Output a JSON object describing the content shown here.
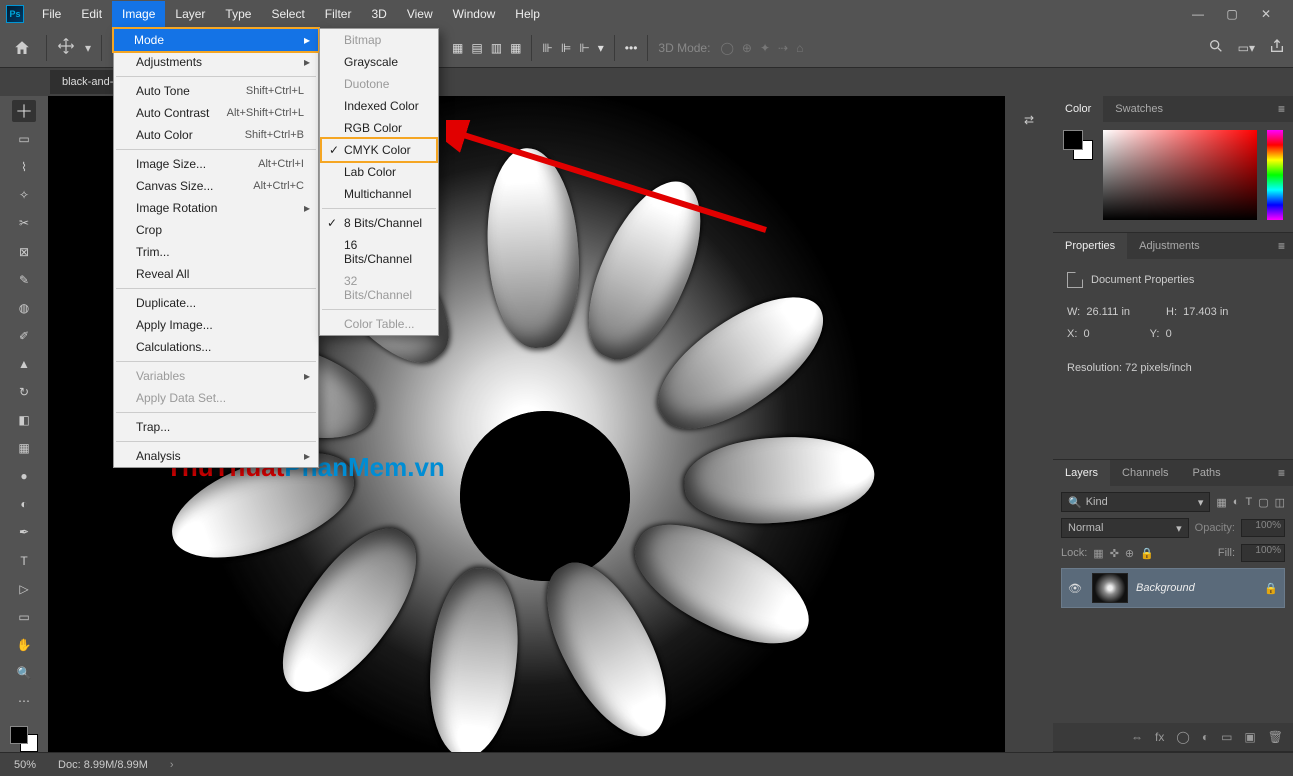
{
  "menubar": [
    "File",
    "Edit",
    "Image",
    "Layer",
    "Type",
    "Select",
    "Filter",
    "3D",
    "View",
    "Window",
    "Help"
  ],
  "active_menu_index": 2,
  "doc_tab": "black-and-",
  "options": {
    "mode3d_label": "3D Mode:"
  },
  "dropdown": {
    "items": [
      {
        "label": "Mode",
        "arrow": true,
        "hl": true
      },
      {
        "label": "Adjustments",
        "arrow": true
      },
      {
        "sep": true
      },
      {
        "label": "Auto Tone",
        "sc": "Shift+Ctrl+L"
      },
      {
        "label": "Auto Contrast",
        "sc": "Alt+Shift+Ctrl+L"
      },
      {
        "label": "Auto Color",
        "sc": "Shift+Ctrl+B"
      },
      {
        "sep": true
      },
      {
        "label": "Image Size...",
        "sc": "Alt+Ctrl+I"
      },
      {
        "label": "Canvas Size...",
        "sc": "Alt+Ctrl+C"
      },
      {
        "label": "Image Rotation",
        "arrow": true
      },
      {
        "label": "Crop"
      },
      {
        "label": "Trim..."
      },
      {
        "label": "Reveal All"
      },
      {
        "sep": true
      },
      {
        "label": "Duplicate..."
      },
      {
        "label": "Apply Image..."
      },
      {
        "label": "Calculations..."
      },
      {
        "sep": true
      },
      {
        "label": "Variables",
        "arrow": true,
        "dis": true
      },
      {
        "label": "Apply Data Set...",
        "dis": true
      },
      {
        "sep": true
      },
      {
        "label": "Trap..."
      },
      {
        "sep": true
      },
      {
        "label": "Analysis",
        "arrow": true
      }
    ]
  },
  "submenu": [
    {
      "label": "Bitmap",
      "dis": true
    },
    {
      "label": "Grayscale"
    },
    {
      "label": "Duotone",
      "dis": true
    },
    {
      "label": "Indexed Color"
    },
    {
      "label": "RGB Color"
    },
    {
      "label": "CMYK Color",
      "chk": true,
      "boxed": true
    },
    {
      "label": "Lab Color"
    },
    {
      "label": "Multichannel"
    },
    {
      "sep": true
    },
    {
      "label": "8 Bits/Channel",
      "chk": true
    },
    {
      "label": "16 Bits/Channel"
    },
    {
      "label": "32 Bits/Channel",
      "dis": true
    },
    {
      "sep": true
    },
    {
      "label": "Color Table...",
      "dis": true
    }
  ],
  "panels": {
    "color_tab": "Color",
    "swatches_tab": "Swatches",
    "props_tab": "Properties",
    "adjust_tab": "Adjustments",
    "props_title": "Document Properties",
    "w_label": "W:",
    "w_val": "26.111 in",
    "h_label": "H:",
    "h_val": "17.403 in",
    "x_label": "X:",
    "x_val": "0",
    "y_label": "Y:",
    "y_val": "0",
    "res_label": "Resolution:",
    "res_val": "72 pixels/inch",
    "layers_tab": "Layers",
    "channels_tab": "Channels",
    "paths_tab": "Paths",
    "kind_label": "Kind",
    "blend_mode": "Normal",
    "opacity_label": "Opacity:",
    "opacity_val": "100%",
    "lock_label": "Lock:",
    "fill_label": "Fill:",
    "fill_val": "100%",
    "layer_name": "Background"
  },
  "status": {
    "zoom": "50%",
    "doc": "Doc: 8.99M/8.99M"
  },
  "watermark": {
    "a": "ThuThuat",
    "b": "PhanMem.vn"
  }
}
